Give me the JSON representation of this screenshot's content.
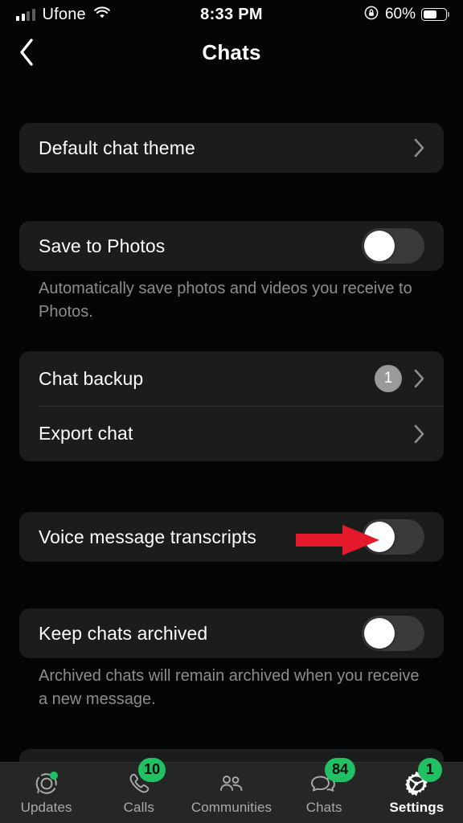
{
  "status_bar": {
    "carrier": "Ufone",
    "time": "8:33 PM",
    "battery_percent": "60%",
    "battery_level": 60,
    "signal_icon": "cellular-signal-icon",
    "wifi_icon": "wifi-icon",
    "rotation_lock_icon": "rotation-lock-icon",
    "battery_icon": "battery-icon"
  },
  "header": {
    "title": "Chats",
    "back_icon": "back-chevron-icon"
  },
  "settings": {
    "theme_row": {
      "label": "Default chat theme",
      "chevron": "chevron-right-icon"
    },
    "save_to_photos": {
      "label": "Save to Photos",
      "toggle_state": "off",
      "footnote": "Automatically save photos and videos you receive to Photos."
    },
    "backup_group": {
      "chat_backup": {
        "label": "Chat backup",
        "badge": "1",
        "chevron": "chevron-right-icon"
      },
      "export_chat": {
        "label": "Export chat",
        "chevron": "chevron-right-icon"
      }
    },
    "voice_transcripts": {
      "label": "Voice message transcripts",
      "toggle_state": "off"
    },
    "keep_archived": {
      "label": "Keep chats archived",
      "toggle_state": "off",
      "footnote": "Archived chats will remain archived when you receive a new message."
    }
  },
  "annotation": {
    "arrow_color": "#e4192b",
    "arrow_icon": "red-arrow-right-icon",
    "points_at": "Voice message transcripts toggle"
  },
  "tabbar": {
    "tabs": [
      {
        "label": "Updates",
        "icon": "updates-status-icon",
        "badge": "",
        "dot": true,
        "active": false
      },
      {
        "label": "Calls",
        "icon": "phone-icon",
        "badge": "10",
        "dot": false,
        "active": false
      },
      {
        "label": "Communities",
        "icon": "communities-icon",
        "badge": "",
        "dot": false,
        "active": false
      },
      {
        "label": "Chats",
        "icon": "chat-bubbles-icon",
        "badge": "84",
        "dot": false,
        "active": false
      },
      {
        "label": "Settings",
        "icon": "gear-icon",
        "badge": "1",
        "dot": false,
        "active": true
      }
    ]
  },
  "colors": {
    "background": "#050505",
    "card": "#1b1c1c",
    "accent_green": "#21c063",
    "toggle_off_track": "#3a3a3c",
    "secondary_text": "#8b8d8e",
    "annotation_red": "#e4192b"
  }
}
